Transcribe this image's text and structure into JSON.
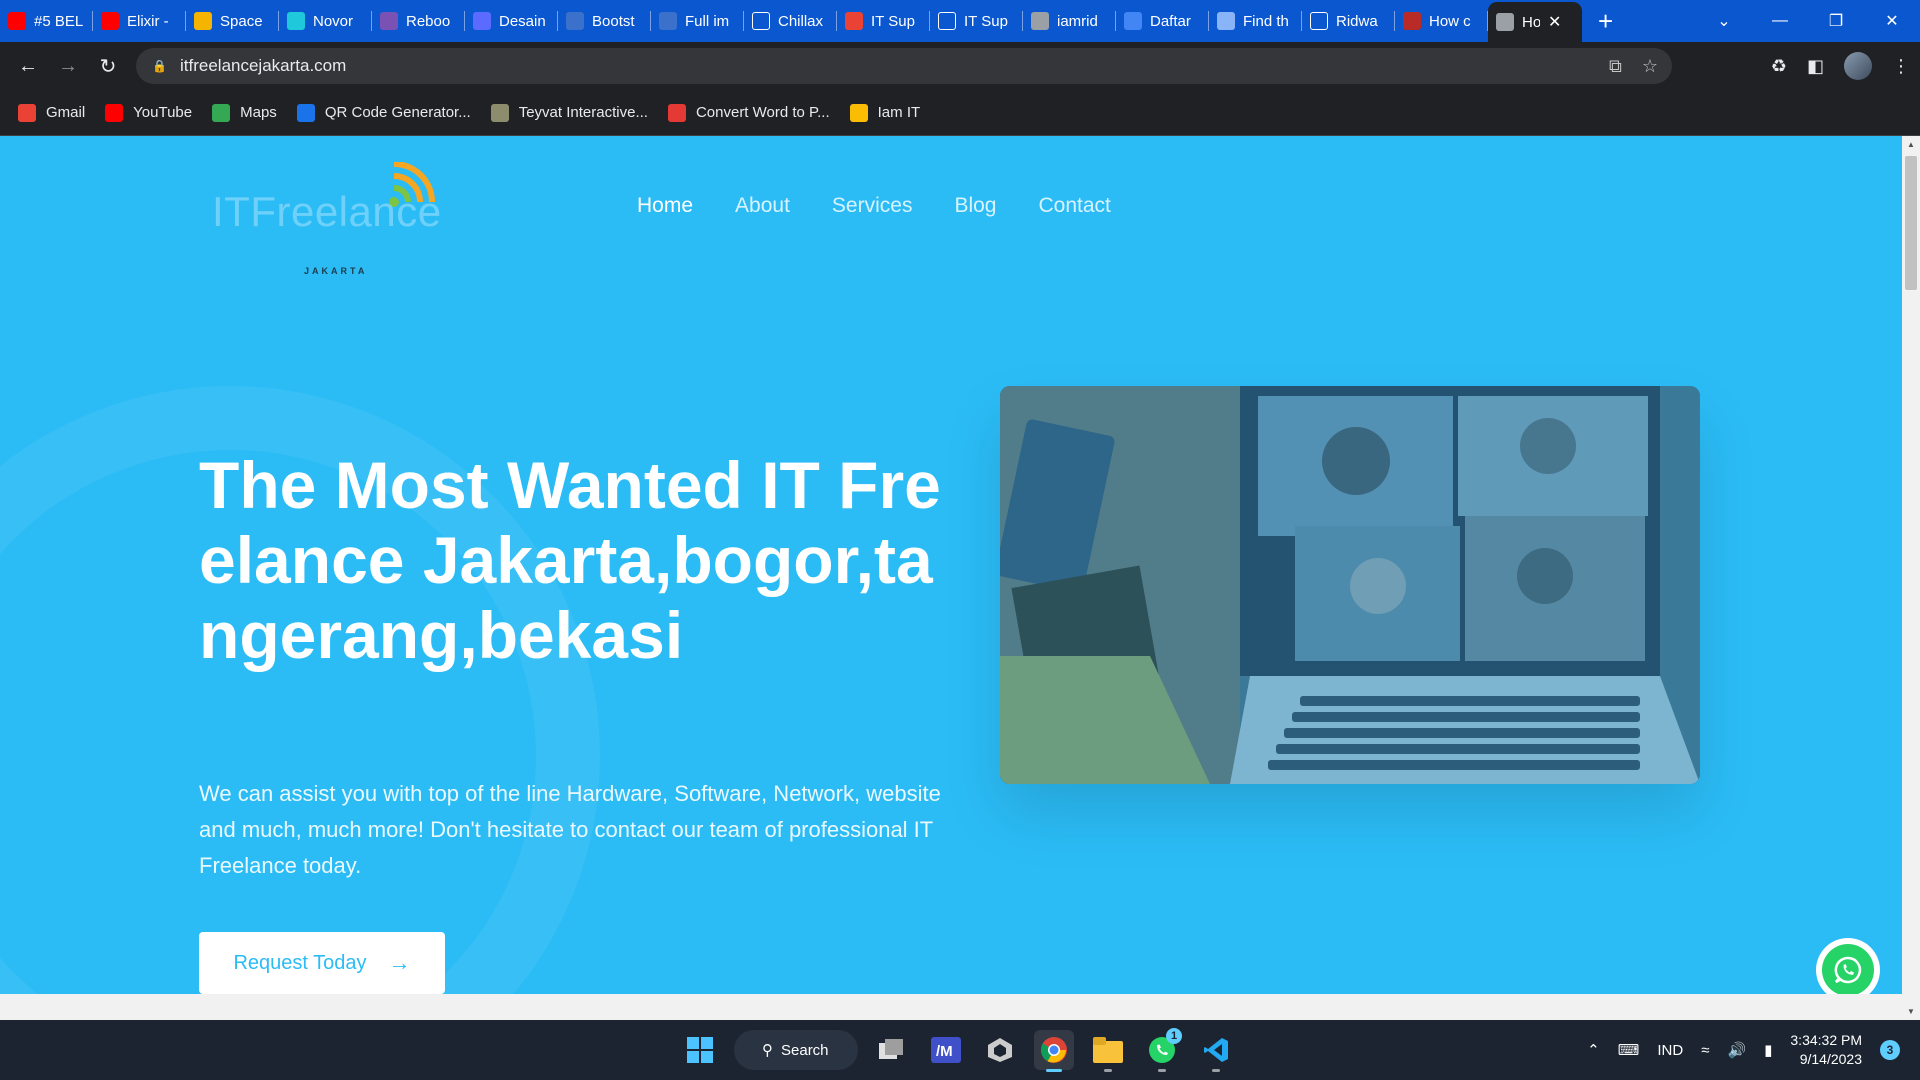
{
  "browser": {
    "tabs": [
      {
        "title": "#5 BEL",
        "icon": "youtube-icon",
        "color": "#ff0000"
      },
      {
        "title": "Elixir -",
        "icon": "youtube-icon",
        "color": "#ff0000"
      },
      {
        "title": "Space",
        "icon": "space-icon",
        "color": "#f4b400"
      },
      {
        "title": "Novor",
        "icon": "novor-icon",
        "color": "#1fc8db"
      },
      {
        "title": "Reboo",
        "icon": "bootstrap-icon",
        "color": "#7952b3"
      },
      {
        "title": "Desain",
        "icon": "calendar-icon",
        "color": "#5b6bff"
      },
      {
        "title": "Bootst",
        "icon": "mdb-icon",
        "color": "#3b71ca"
      },
      {
        "title": "Full im",
        "icon": "mdb-icon",
        "color": "#3b71ca"
      },
      {
        "title": "Chillax",
        "icon": "font-f-icon",
        "color": "#ffffff"
      },
      {
        "title": "IT Sup",
        "icon": "gmail-icon",
        "color": "#ea4335"
      },
      {
        "title": "IT Sup",
        "icon": "info-icon",
        "color": "#ffffff"
      },
      {
        "title": "iamrid",
        "icon": "globe-icon",
        "color": "#9aa0a6"
      },
      {
        "title": "Daftar",
        "icon": "wave-icon",
        "color": "#4285f4"
      },
      {
        "title": "Find th",
        "icon": "flag-icon",
        "color": "#8ab4f8"
      },
      {
        "title": "Ridwa",
        "icon": "github-icon",
        "color": "#ffffff"
      },
      {
        "title": "How c",
        "icon": "quora-icon",
        "color": "#b92b27"
      },
      {
        "title": "Ho",
        "icon": "arrow-icon",
        "color": "#9aa0a6",
        "active": true
      }
    ],
    "url": "itfreelancejakarta.com",
    "bookmarks": [
      {
        "label": "Gmail",
        "icon": "gmail-icon",
        "color": "#ea4335"
      },
      {
        "label": "YouTube",
        "icon": "youtube-icon",
        "color": "#ff0000"
      },
      {
        "label": "Maps",
        "icon": "maps-pin-icon",
        "color": "#34a853"
      },
      {
        "label": "QR Code Generator...",
        "icon": "qr-icon",
        "color": "#1a73e8"
      },
      {
        "label": "Teyvat Interactive...",
        "icon": "teyvat-icon",
        "color": "#8d8d6e"
      },
      {
        "label": "Convert Word to P...",
        "icon": "heart-icon",
        "color": "#e53935"
      },
      {
        "label": "Iam IT",
        "icon": "drive-icon",
        "color": "#fbbc04"
      }
    ]
  },
  "site": {
    "logo_text": "ITFreelance",
    "logo_sub": "JAKARTA",
    "nav": [
      "Home",
      "About",
      "Services",
      "Blog",
      "Contact"
    ],
    "hero_title": "The Most Wanted IT Freelance Jakarta,bogor,tangerang,bekasi",
    "hero_description": "We can assist you with top of the line Hardware, Software, Network, website and much, much more! Don't hesitate to contact our team of professional IT Freelance today.",
    "cta_label": "Request Today",
    "colors": {
      "background": "#2bbcf6",
      "text": "#ffffff",
      "whatsapp": "#25d366"
    }
  },
  "taskbar": {
    "search_label": "Search",
    "apps": [
      "start-icon",
      "task-view-icon",
      "mathpix-icon",
      "unity-icon",
      "chrome-icon",
      "file-explorer-icon",
      "whatsapp-icon",
      "vscode-icon"
    ],
    "whatsapp_badge": "1",
    "language": "IND",
    "time": "3:34:32 PM",
    "date": "9/14/2023",
    "notification_count": "3"
  }
}
